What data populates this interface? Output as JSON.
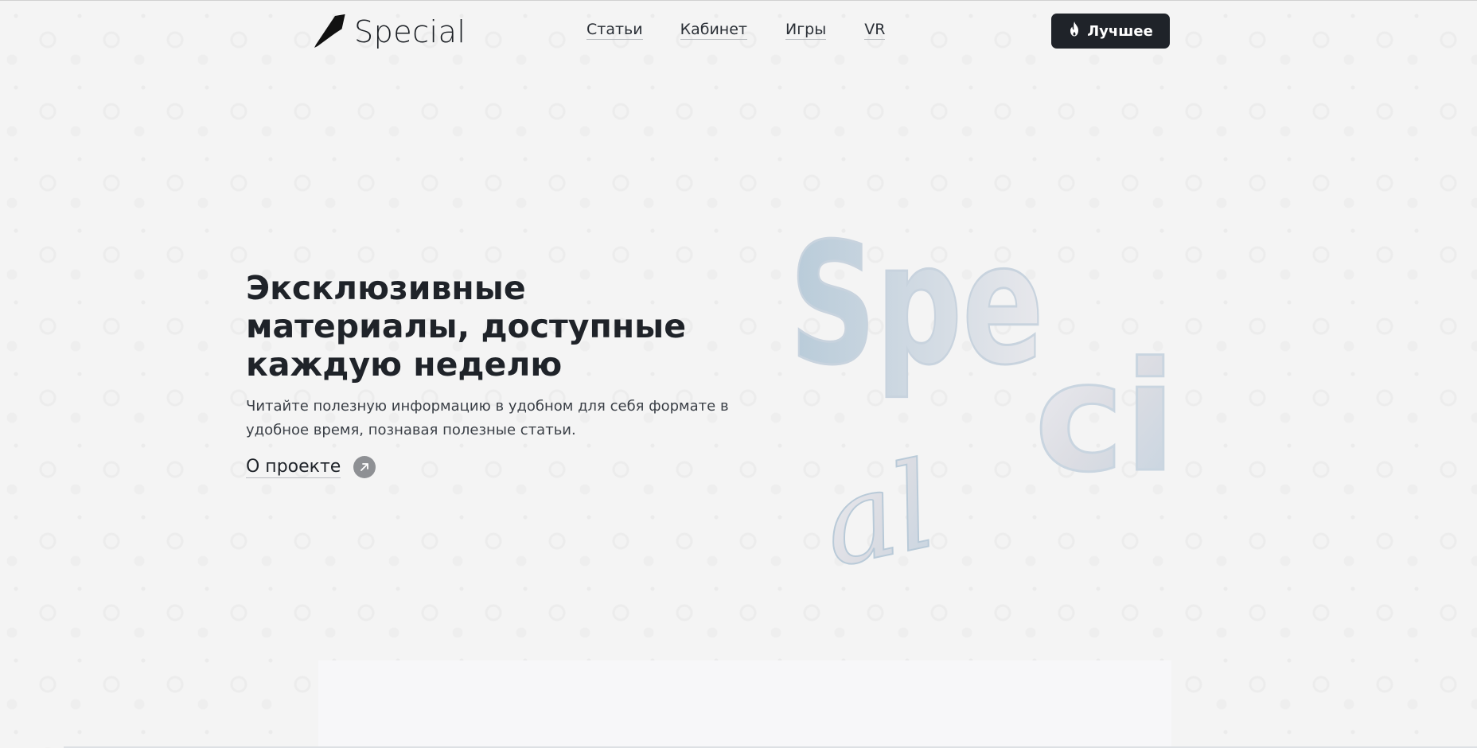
{
  "header": {
    "logo_text": "Special",
    "logo_icon": "pen-nib-icon",
    "nav": [
      {
        "label": "Статьи"
      },
      {
        "label": "Кабинет"
      },
      {
        "label": "Игры"
      },
      {
        "label": "VR"
      }
    ],
    "cta_label": "Лучшее",
    "cta_icon": "flame-icon"
  },
  "hero": {
    "title": "Эксклюзивные материалы, доступные каждую неделю",
    "description": "Читайте полезную информацию в удобном для себя формате в удобное время, познавая полезные статьи.",
    "about_label": "О проекте",
    "about_icon": "arrow-up-right-icon",
    "art_letters": [
      "Spe",
      "ci",
      "al"
    ]
  },
  "colors": {
    "dark": "#1f2329",
    "background": "#f4f4f4",
    "icon_gray": "#8e9094"
  }
}
